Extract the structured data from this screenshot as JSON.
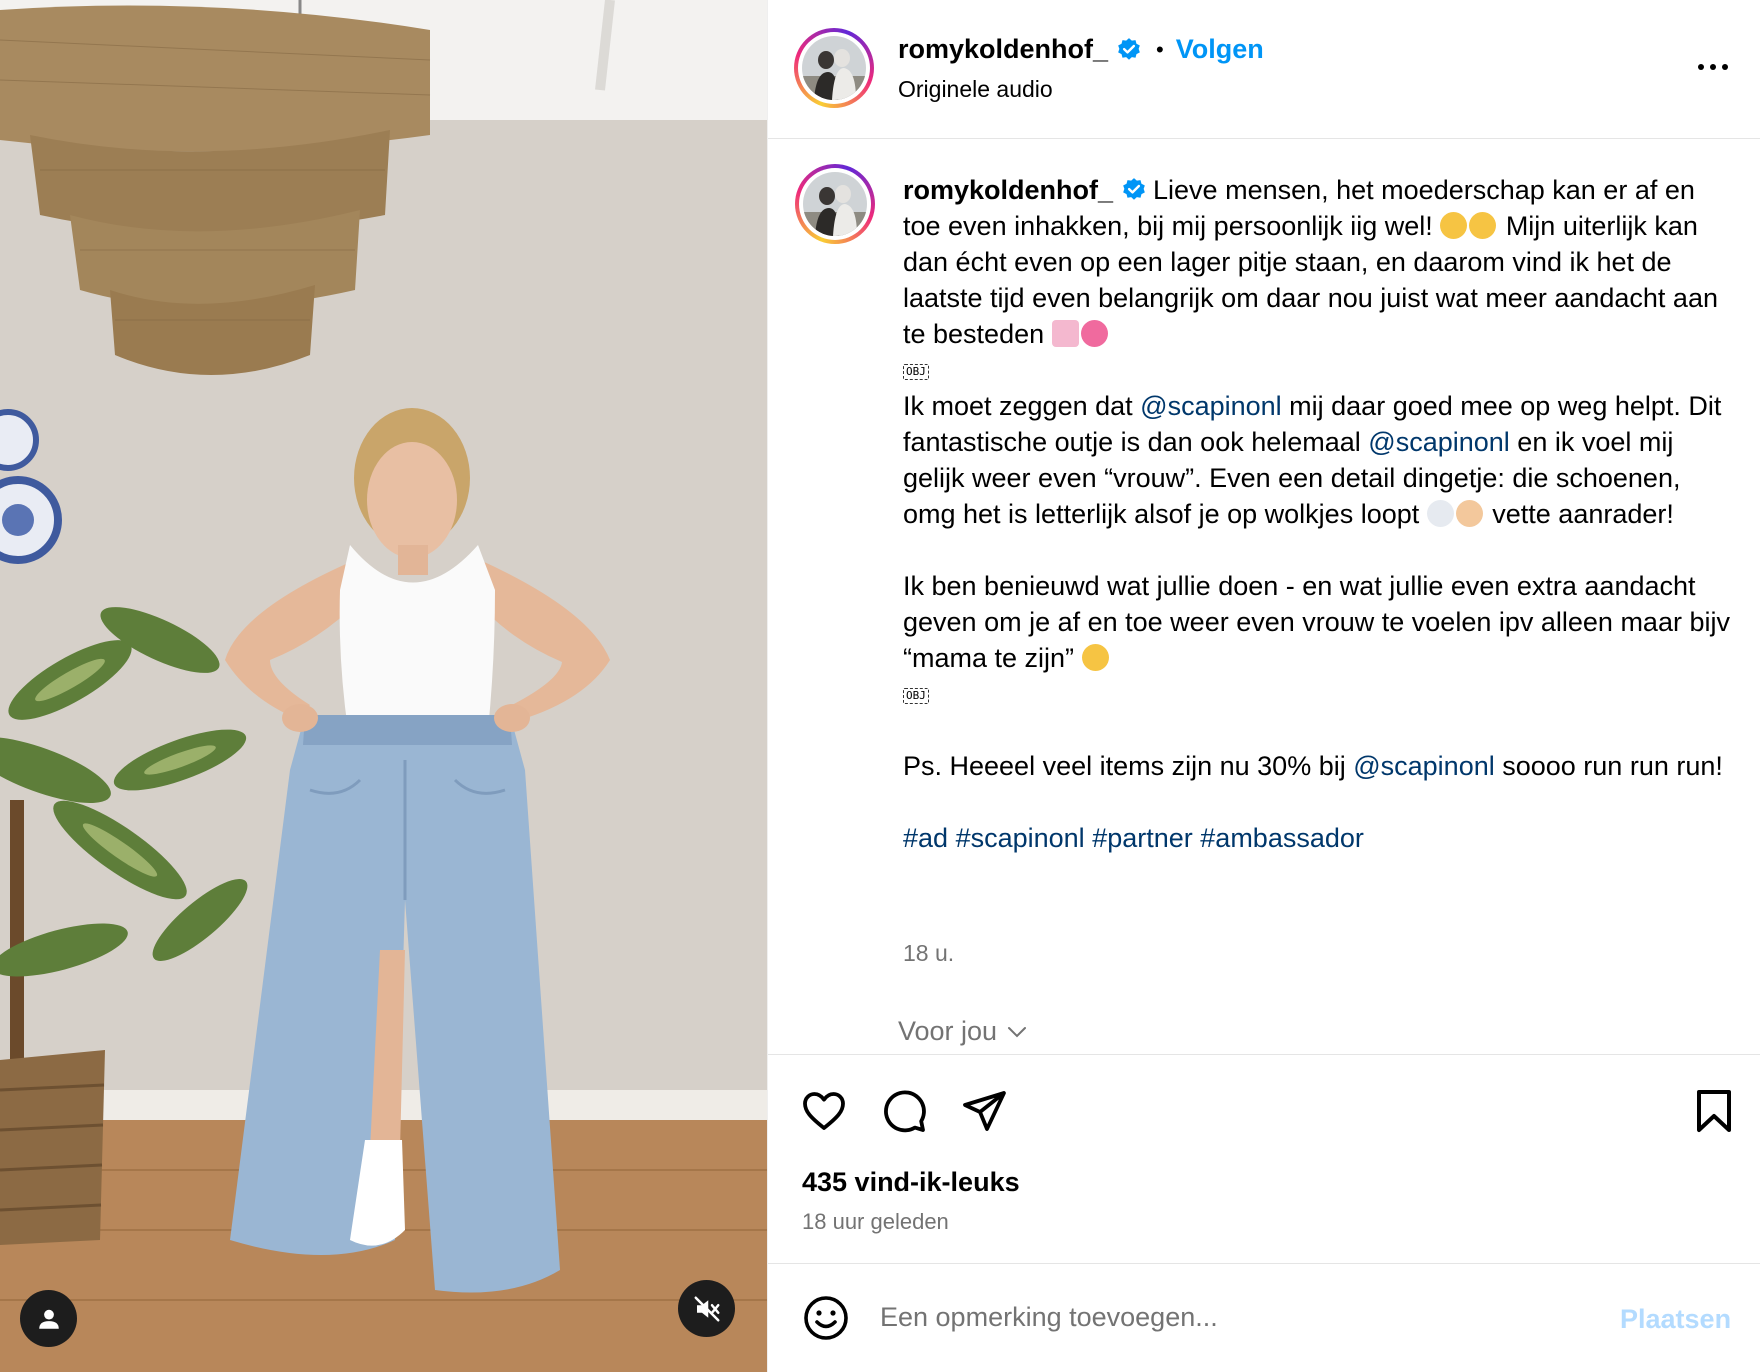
{
  "post": {
    "username": "romykoldenhof_",
    "follow_label": "Volgen",
    "separator": "•",
    "audio_label": "Originele audio",
    "icons": {
      "verified": "verified-badge-icon",
      "more": "more-options-icon",
      "tag": "user-tag-icon",
      "mute": "muted-speaker-icon"
    }
  },
  "caption": {
    "username": "romykoldenhof_",
    "p1_text": "Lieve mensen, het moederschap kan er af en toe even inhakken, bij mij persoonlijk iig wel!",
    "p1_text2": "Mijn uiterlijk kan dan écht even op een lager pitje staan, en daarom vind ik het de laatste tijd even belangrijk om daar nou juist wat meer aandacht aan te besteden",
    "obj_label": "OBJ",
    "p2_a": "Ik moet zeggen dat ",
    "p2_mention1": "@scapinonl",
    "p2_b": " mij daar goed mee op weg helpt. Dit fantastische outje is dan ook helemaal ",
    "p2_mention2": "@scapinonl",
    "p2_c": " en ik voel mij gelijk weer even “vrouw”. Even een detail dingetje: die schoenen, omg het is letterlijk alsof je op wolkjes loopt",
    "p2_d": " vette aanrader!",
    "p3": "Ik ben benieuwd wat jullie doen - en wat jullie even extra aandacht geven om je af en toe weer even vrouw te voelen ipv alleen maar bijv “mama te zijn”",
    "p4_a": "Ps. Heeeel veel items zijn nu 30% bij ",
    "p4_mention": "@scapinonl",
    "p4_b": " soooo run run run!",
    "hashtags": [
      "#ad",
      "#scapinonl",
      "#partner",
      "#ambassador"
    ],
    "time": "18 u.",
    "voor_jou": "Voor jou"
  },
  "actions": {
    "icons": [
      "heart-icon",
      "comment-icon",
      "share-icon",
      "bookmark-icon"
    ],
    "likes": "435 vind-ik-leuks",
    "posted": "18 uur geleden"
  },
  "comment": {
    "placeholder": "Een opmerking toevoegen...",
    "post_label": "Plaatsen"
  },
  "colors": {
    "accent": "#0095f6",
    "link": "#00376b",
    "muted": "#737373",
    "disabled_post": "#b3dbff"
  }
}
